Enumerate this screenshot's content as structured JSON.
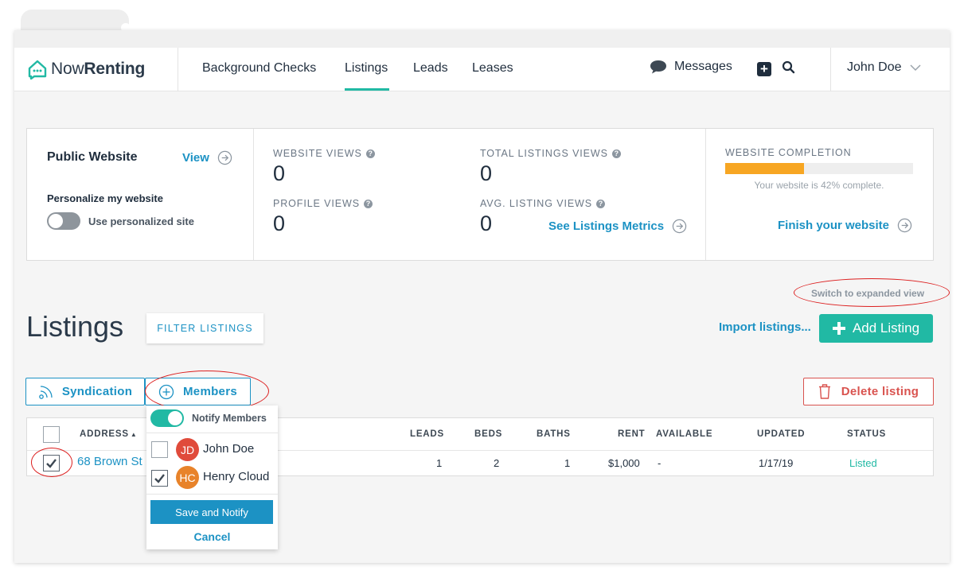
{
  "brand": {
    "name_regular": "Now",
    "name_bold": "Renting"
  },
  "nav": {
    "links": [
      "Background Checks",
      "Listings",
      "Leads",
      "Leases"
    ],
    "messages": "Messages",
    "user": "John Doe"
  },
  "website_card": {
    "title": "Public Website",
    "view_link": "View",
    "personalize_title": "Personalize my website",
    "toggle_label": "Use personalized site"
  },
  "stats": {
    "website_views_label": "WEBSITE VIEWS",
    "website_views": "0",
    "profile_views_label": "PROFILE VIEWS",
    "profile_views": "0",
    "total_listings_views_label": "TOTAL LISTINGS VIEWS",
    "total_listings_views": "0",
    "avg_listing_views_label": "AVG. LISTING VIEWS",
    "avg_listing_views": "0",
    "metrics_link": "See Listings Metrics"
  },
  "completion": {
    "label": "WEBSITE COMPLETION",
    "percent": 42,
    "text": "Your website is 42% complete.",
    "finish_link": "Finish your website"
  },
  "listings": {
    "title": "Listings",
    "filter_button": "FILTER LISTINGS",
    "expanded_link": "Switch to expanded view",
    "import_link": "Import listings...",
    "add_button": "Add Listing",
    "syndication_button": "Syndication",
    "members_button": "Members",
    "delete_button": "Delete listing",
    "columns": {
      "address": "ADDRESS",
      "leads": "LEADS",
      "beds": "BEDS",
      "baths": "BATHS",
      "rent": "RENT",
      "available": "AVAILABLE",
      "updated": "UPDATED",
      "status": "STATUS"
    },
    "row": {
      "address": "68 Brown St",
      "leads": "1",
      "beds": "2",
      "baths": "1",
      "rent": "$1,000",
      "available": "-",
      "updated": "1/17/19",
      "status": "Listed"
    }
  },
  "members_dropdown": {
    "notify_label": "Notify Members",
    "members": [
      {
        "initials": "JD",
        "name": "John Doe",
        "checked": false,
        "color": "#e04b3b"
      },
      {
        "initials": "HC",
        "name": "Henry Cloud",
        "checked": true,
        "color": "#e8832a"
      }
    ],
    "save_button": "Save and Notify",
    "cancel": "Cancel"
  },
  "colors": {
    "accent_teal": "#21b9a4",
    "link_blue": "#1c92c4",
    "danger_red": "#d9534f",
    "progress_orange": "#f7a623",
    "annotation_red": "#dc1f1f"
  }
}
